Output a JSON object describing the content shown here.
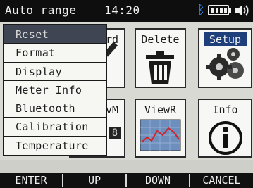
{
  "status_bar": {
    "mode": "Auto range",
    "time": "14:20",
    "icons": [
      "bluetooth-icon",
      "battery-icon",
      "speaker-icon"
    ]
  },
  "tiles": {
    "record_partial": "rd",
    "delete": "Delete",
    "setup": "Setup",
    "viewm_partial": "vM",
    "viewm_value": "8",
    "viewr": "ViewR",
    "info": "Info"
  },
  "menu": {
    "selected_index": 0,
    "items": [
      "Reset",
      "Format",
      "Display",
      "Meter Info",
      "Bluetooth",
      "Calibration",
      "Temperature"
    ]
  },
  "softkeys": [
    "ENTER",
    "UP",
    "DOWN",
    "CANCEL"
  ],
  "colors": {
    "top_bar": "#0e0e0f",
    "selected_menu": "#3f4552",
    "setup_highlight": "#1f3f7b",
    "bluetooth": "#3a8bff"
  }
}
